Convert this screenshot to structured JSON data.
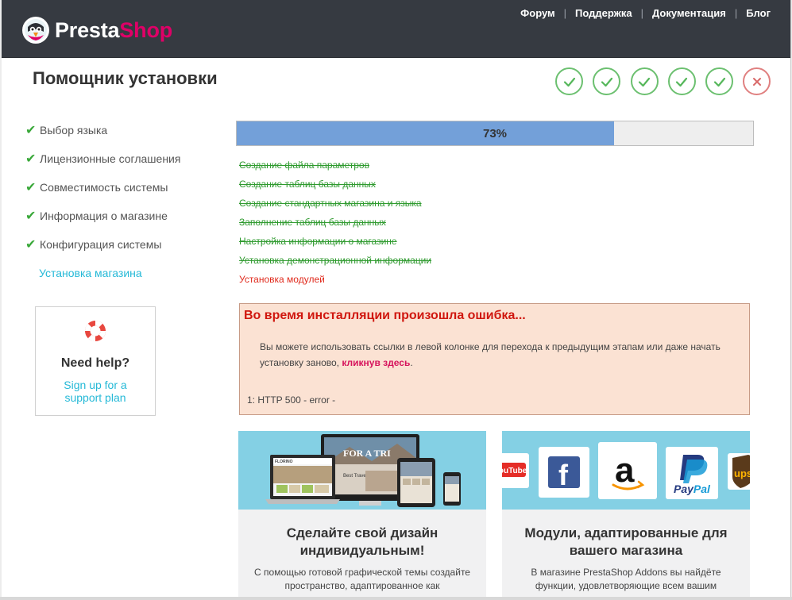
{
  "header": {
    "logo_presta": "Presta",
    "logo_shop": "Shop",
    "nav": [
      "Форум",
      "Поддержка",
      "Документация",
      "Блог"
    ]
  },
  "page_title": "Помощник установки",
  "sidebar": {
    "steps": [
      {
        "label": "Выбор языка",
        "done": true
      },
      {
        "label": "Лицензионные соглашения",
        "done": true
      },
      {
        "label": "Совместимость системы",
        "done": true
      },
      {
        "label": "Информация о магазине",
        "done": true
      },
      {
        "label": "Конфигурация системы",
        "done": true
      },
      {
        "label": "Установка магазина",
        "done": false
      }
    ]
  },
  "help": {
    "title": "Need help?",
    "link": "Sign up for a support plan"
  },
  "progress": {
    "percent": 73,
    "label": "73%"
  },
  "tasks": [
    {
      "label": "Создание файла параметров",
      "status": "done"
    },
    {
      "label": "Создание таблиц базы данных",
      "status": "done"
    },
    {
      "label": "Создание стандартных магазина и языка",
      "status": "done"
    },
    {
      "label": "Заполнение таблиц базы данных",
      "status": "done"
    },
    {
      "label": "Настройка информации о магазине",
      "status": "done"
    },
    {
      "label": "Установка демонстрационной информации",
      "status": "done"
    },
    {
      "label": "Установка модулей",
      "status": "active"
    }
  ],
  "error": {
    "title": "Во время инсталляции произошла ошибка...",
    "text": "Вы можете использовать ссылки в левой колонке для перехода к предыдущим этапам или даже начать установку заново,",
    "link": "кликнув здесь",
    "text_end": ".",
    "code": "1: HTTP 500 - error -"
  },
  "cards": [
    {
      "title": "Сделайте свой дизайн индивидуальным!",
      "text": "С помощью готовой графической темы создайте пространство, адаптированное как"
    },
    {
      "title": "Модули, адаптированные для вашего магазина",
      "text": "В магазине PrestaShop Addons вы найдёте функции, удовлетворяющие всем вашим"
    }
  ],
  "card_images": {
    "banner_text": "FOR A TRI",
    "site_name": "FLORINO",
    "site_caption": "Best Travel",
    "youtube": "YouTube",
    "paypal_pay": "Pay",
    "paypal_pal": "Pal",
    "ups": "ups"
  },
  "colors": {
    "header_bg": "#363a41",
    "brand_pink": "#df0067",
    "link_blue": "#25b9d7",
    "check_green": "#39a839",
    "progress_fill": "#73a0d9",
    "error_red": "#d0170f"
  }
}
